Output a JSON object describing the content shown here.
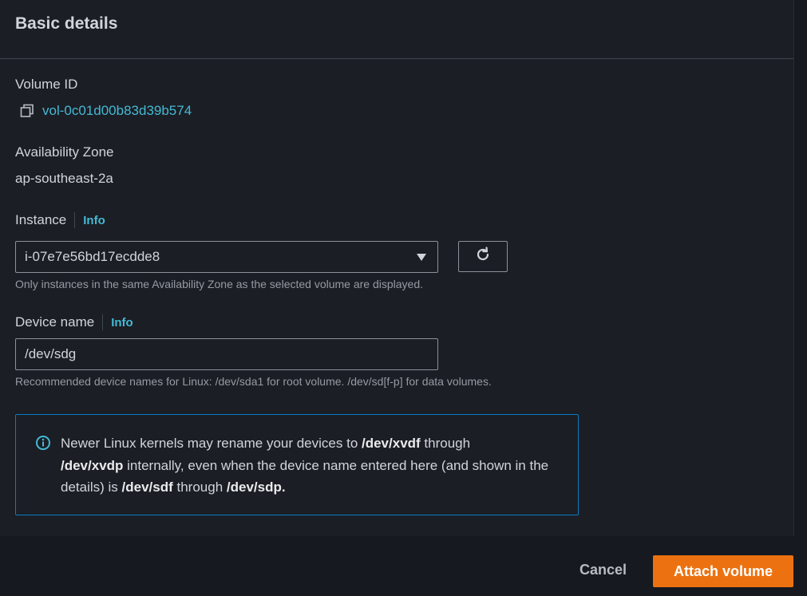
{
  "section": {
    "title": "Basic details"
  },
  "volume": {
    "label": "Volume ID",
    "id": "vol-0c01d00b83d39b574",
    "copy_icon": "copy-icon"
  },
  "availability_zone": {
    "label": "Availability Zone",
    "value": "ap-southeast-2a"
  },
  "instance": {
    "label": "Instance",
    "info": "Info",
    "selected": "i-07e7e56bd17ecdde8",
    "hint": "Only instances in the same Availability Zone as the selected volume are displayed.",
    "refresh_icon": "refresh-icon"
  },
  "device_name": {
    "label": "Device name",
    "info": "Info",
    "value": "/dev/sdg",
    "hint": "Recommended device names for Linux: /dev/sda1 for root volume. /dev/sd[f-p] for data volumes."
  },
  "alert": {
    "icon": "info-circle-icon",
    "text_1": "Newer Linux kernels may rename your devices to ",
    "bold_1": "/dev/xvdf",
    "text_2": " through ",
    "bold_2": "/dev/xvdp",
    "text_3": " internally, even when the device name entered here (and shown in the details) is ",
    "bold_3": "/dev/sdf",
    "text_4": " through ",
    "bold_4": "/dev/sdp."
  },
  "footer": {
    "cancel_label": "Cancel",
    "primary_label": "Attach volume"
  },
  "colors": {
    "accent_link": "#44b9d6",
    "primary_button": "#ec7211",
    "alert_border": "#0a7bc1",
    "background": "#1b1e24"
  }
}
